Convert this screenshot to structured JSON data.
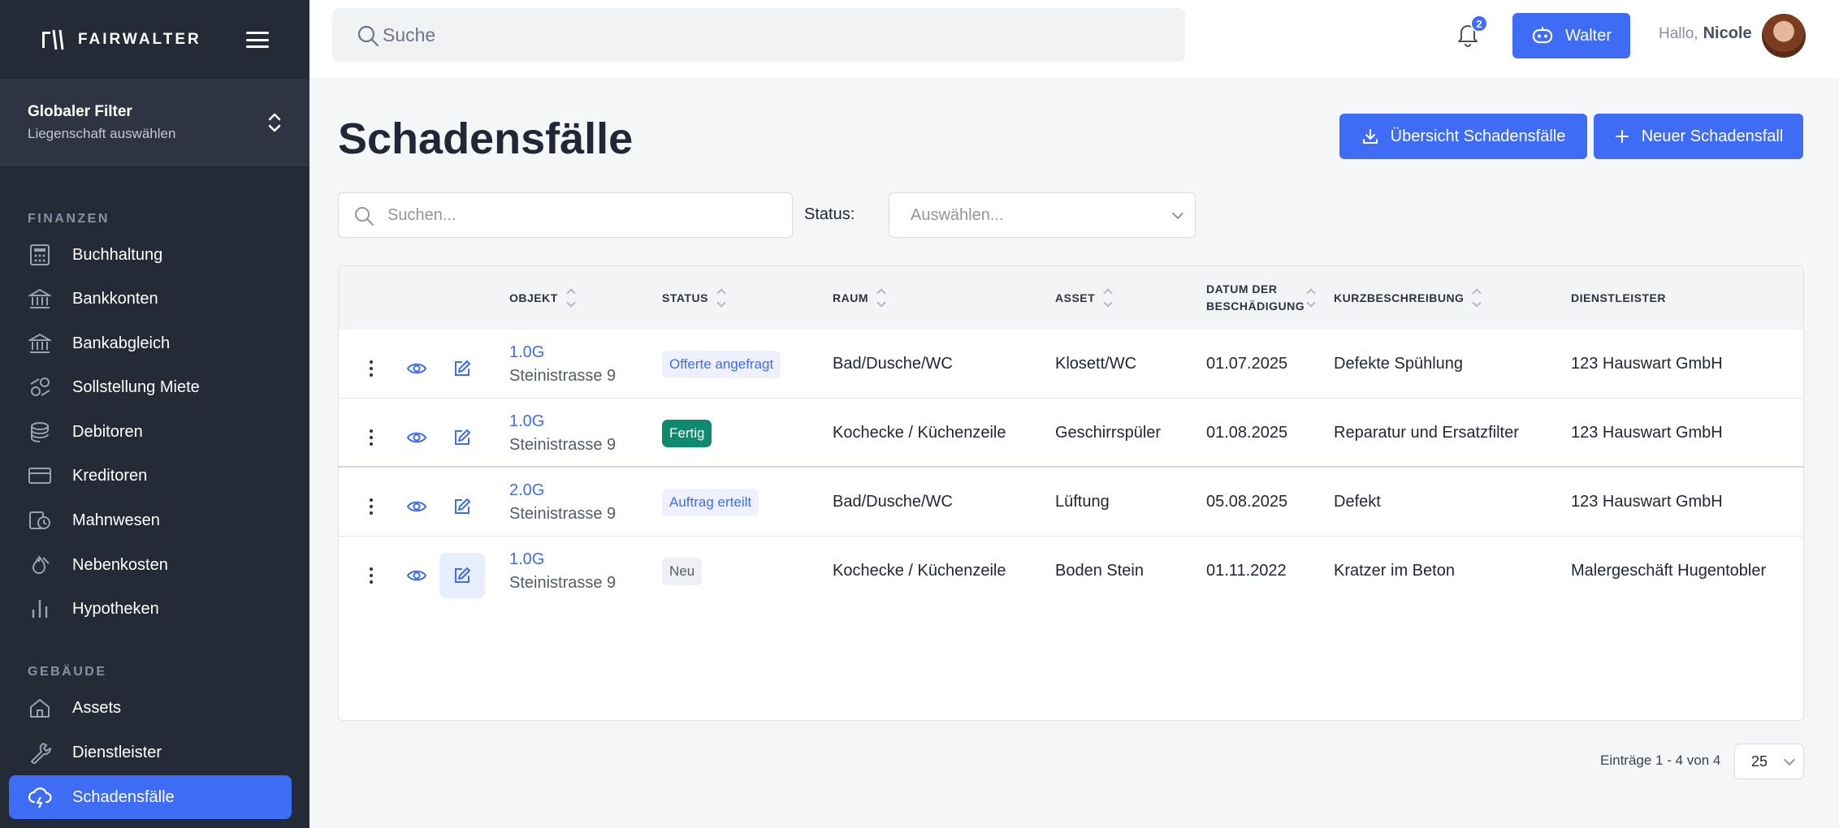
{
  "app": {
    "brand": "FAIRWALTER"
  },
  "sidebar": {
    "filter": {
      "title": "Globaler Filter",
      "subtitle": "Liegenschaft auswählen"
    },
    "sections": {
      "finanzen": "FINANZEN",
      "gebaeude": "GEBÄUDE"
    },
    "items": [
      {
        "label": "Buchhaltung",
        "icon": "calculator-icon"
      },
      {
        "label": "Bankkonten",
        "icon": "bank-icon"
      },
      {
        "label": "Bankabgleich",
        "icon": "bank-icon"
      },
      {
        "label": "Sollstellung Miete",
        "icon": "coins-icon"
      },
      {
        "label": "Debitoren",
        "icon": "coin-stack-icon"
      },
      {
        "label": "Kreditoren",
        "icon": "credit-card-icon"
      },
      {
        "label": "Mahnwesen",
        "icon": "reminder-icon"
      },
      {
        "label": "Nebenkosten",
        "icon": "flame-icon"
      },
      {
        "label": "Hypotheken",
        "icon": "bar-chart-icon"
      },
      {
        "label": "Assets",
        "icon": "house-icon"
      },
      {
        "label": "Dienstleister",
        "icon": "wrench-icon"
      },
      {
        "label": "Schadensfälle",
        "icon": "storm-cloud-icon",
        "active": true
      }
    ]
  },
  "topbar": {
    "search_placeholder": "Suche",
    "notifications_count": "2",
    "assistant_label": "Walter",
    "greeting": "Hallo,",
    "user_name": "Nicole"
  },
  "main": {
    "title": "Schadensfälle",
    "buttons": {
      "overview": "Übersicht Schadensfälle",
      "new": "Neuer Schadensfall"
    },
    "search_placeholder": "Suchen...",
    "status_label": "Status:",
    "status_placeholder": "Auswählen..."
  },
  "table": {
    "headers": {
      "objekt": "OBJEKT",
      "status": "STATUS",
      "raum": "RAUM",
      "asset": "ASSET",
      "datum_line1": "DATUM DER",
      "datum_line2": "BESCHÄDIGUNG",
      "kurz": "KURZBESCHREIBUNG",
      "dienstleister": "DIENSTLEISTER"
    },
    "rows": [
      {
        "objekt": "1.0G",
        "adresse": "Steinistrasse 9",
        "status": "Offerte angefragt",
        "raum": "Bad/Dusche/WC",
        "asset": "Klosett/WC",
        "datum": "01.07.2025",
        "kurz": "Defekte Spühlung",
        "dienstleister": "123 Hauswart GmbH"
      },
      {
        "objekt": "1.0G",
        "adresse": "Steinistrasse 9",
        "status": "Fertig",
        "raum": "Kochecke / Küchenzeile",
        "asset": "Geschirrspüler",
        "datum": "01.08.2025",
        "kurz": "Reparatur und Ersatzfilter",
        "dienstleister": "123 Hauswart GmbH"
      },
      {
        "objekt": "2.0G",
        "adresse": "Steinistrasse 9",
        "status": "Auftrag erteilt",
        "raum": "Bad/Dusche/WC",
        "asset": "Lüftung",
        "datum": "05.08.2025",
        "kurz": "Defekt",
        "dienstleister": "123 Hauswart GmbH"
      },
      {
        "objekt": "1.0G",
        "adresse": "Steinistrasse 9",
        "status": "Neu",
        "raum": "Kochecke / Küchenzeile",
        "asset": "Boden Stein",
        "datum": "01.11.2022",
        "kurz": "Kratzer im Beton",
        "dienstleister": "Malergeschäft Hugentobler"
      }
    ]
  },
  "pagination": {
    "summary": "Einträge 1 - 4 von 4",
    "page_size": "25"
  },
  "colors": {
    "sidebar_bg": "#252a37",
    "accent": "#3e6cf4",
    "status_done": "#108a6f"
  }
}
